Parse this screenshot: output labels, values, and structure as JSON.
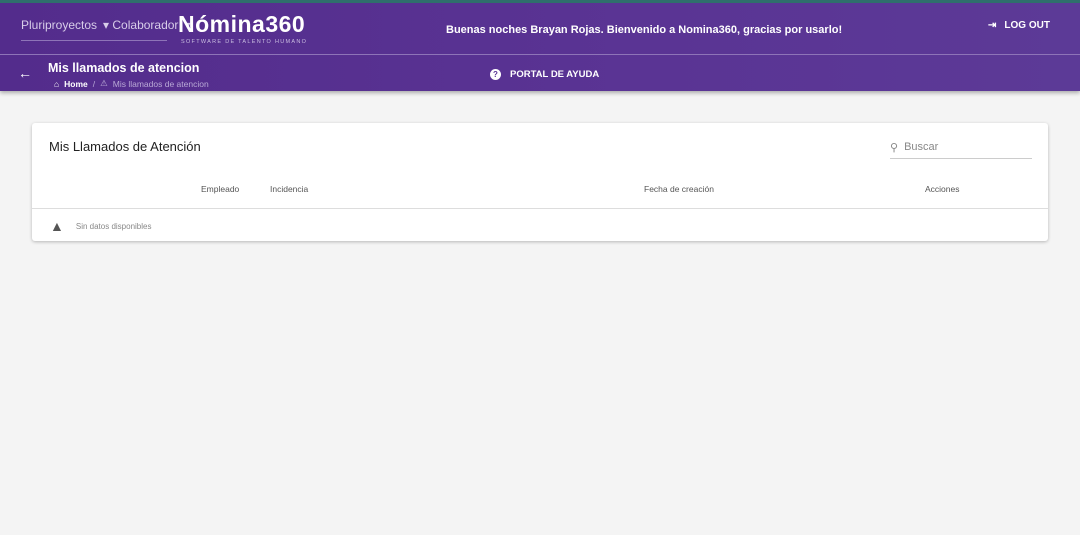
{
  "header": {
    "nav": [
      "Pluriproyectos",
      "Colaborador"
    ],
    "logo": "Nómina360",
    "logo_sub": "SOFTWARE DE TALENTO HUMANO",
    "greeting": "Buenas noches Brayan Rojas. Bienvenido a Nomina360, gracias por usarlo!",
    "logout": "LOG OUT"
  },
  "subheader": {
    "title": "Mis llamados de atencion",
    "breadcrumb": {
      "home": "Home",
      "current": "Mis llamados de atencion"
    },
    "help": "PORTAL DE AYUDA"
  },
  "card": {
    "title": "Mis Llamados de Atención",
    "search_placeholder": "Buscar",
    "columns": [
      "Empleado",
      "Incidencia",
      "Fecha de creación",
      "Acciones"
    ],
    "empty": "Sin datos disponibles"
  }
}
